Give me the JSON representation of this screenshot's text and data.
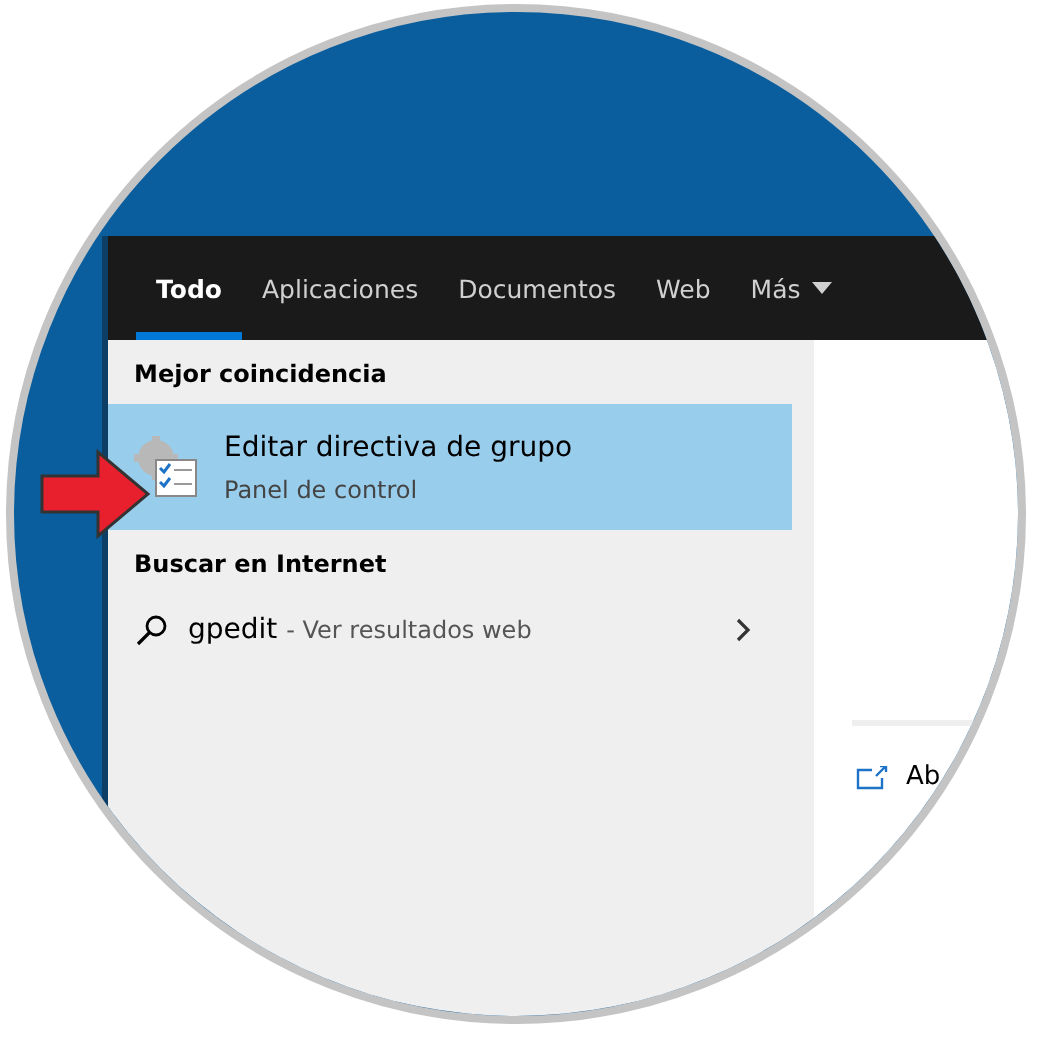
{
  "tabs": [
    {
      "label": "Todo",
      "selected": true
    },
    {
      "label": "Aplicaciones",
      "selected": false
    },
    {
      "label": "Documentos",
      "selected": false
    },
    {
      "label": "Web",
      "selected": false
    },
    {
      "label": "Más",
      "selected": false,
      "kind": "dropdown"
    }
  ],
  "best_match": {
    "heading": "Mejor coincidencia",
    "title": "Editar directiva de grupo",
    "subtitle": "Panel de control",
    "selected": true
  },
  "web_search": {
    "heading": "Buscar en Internet",
    "query": "gpedit",
    "hint": "- Ver resultados web"
  },
  "preview": {
    "action": "Ab"
  }
}
